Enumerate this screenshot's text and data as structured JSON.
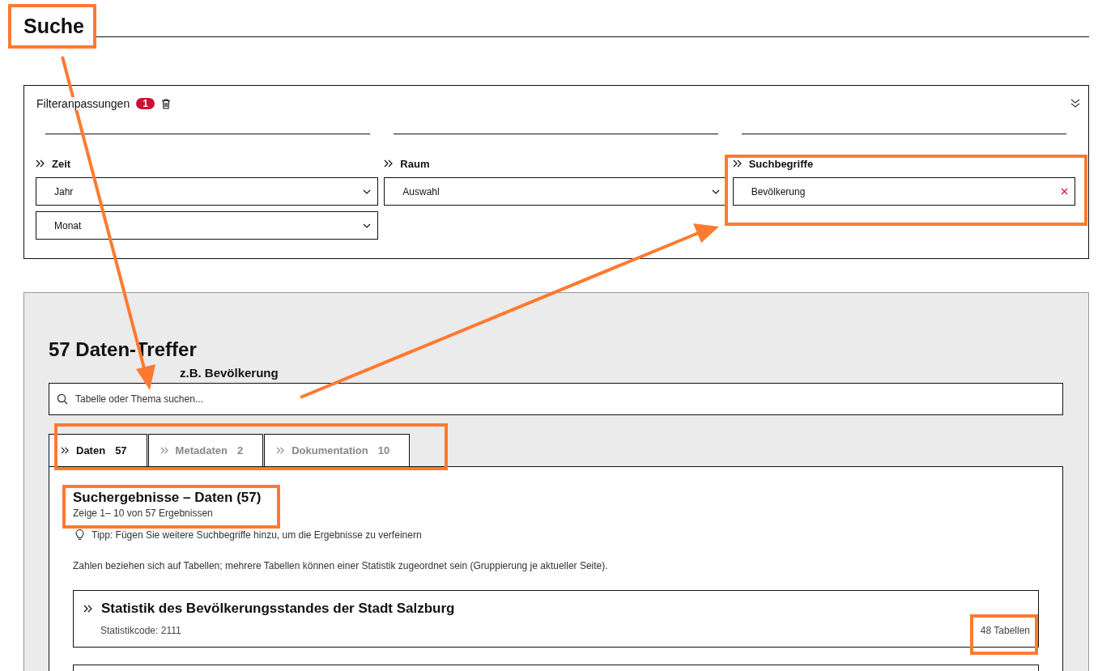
{
  "page": {
    "title": "Suche"
  },
  "filters": {
    "title": "Filteranpassungen",
    "count": "1",
    "groups": [
      {
        "label": "Zeit",
        "kind": "select",
        "fields": [
          {
            "value": "Jahr"
          },
          {
            "value": "Monat"
          }
        ]
      },
      {
        "label": "Raum",
        "kind": "select",
        "fields": [
          {
            "value": "Auswahl"
          }
        ]
      },
      {
        "label": "Suchbegriffe",
        "kind": "text",
        "fields": [
          {
            "value": "Bevölkerung"
          }
        ]
      }
    ]
  },
  "results": {
    "heading": "57 Daten-Treffer",
    "search": {
      "placeholder": "Tabelle oder Thema suchen..."
    },
    "tabs": [
      {
        "label": "Daten",
        "count": "57",
        "selected": true
      },
      {
        "label": "Metadaten",
        "count": "2",
        "selected": false
      },
      {
        "label": "Dokumentation",
        "count": "10",
        "selected": false
      }
    ],
    "panel": {
      "title": "Suchergebnisse – Daten (57)",
      "subtitle": "Zeige 1– 10 von 57 Ergebnissen",
      "tip": "Tipp: Fügen Sie weitere Suchbegriffe hinzu, um die Ergebnisse zu verfeinern",
      "note": "Zahlen beziehen sich auf Tabellen; mehrere Tabellen können einer Statistik zugeordnet sein (Gruppierung je aktueller Seite).",
      "cards": [
        {
          "title": "Statistik des Bevölkerungsstandes der Stadt Salzburg",
          "code": "Statistikcode: 2111",
          "tables": "48 Tabellen"
        }
      ]
    }
  },
  "annotation_note": "z.B. Bevölkerung"
}
